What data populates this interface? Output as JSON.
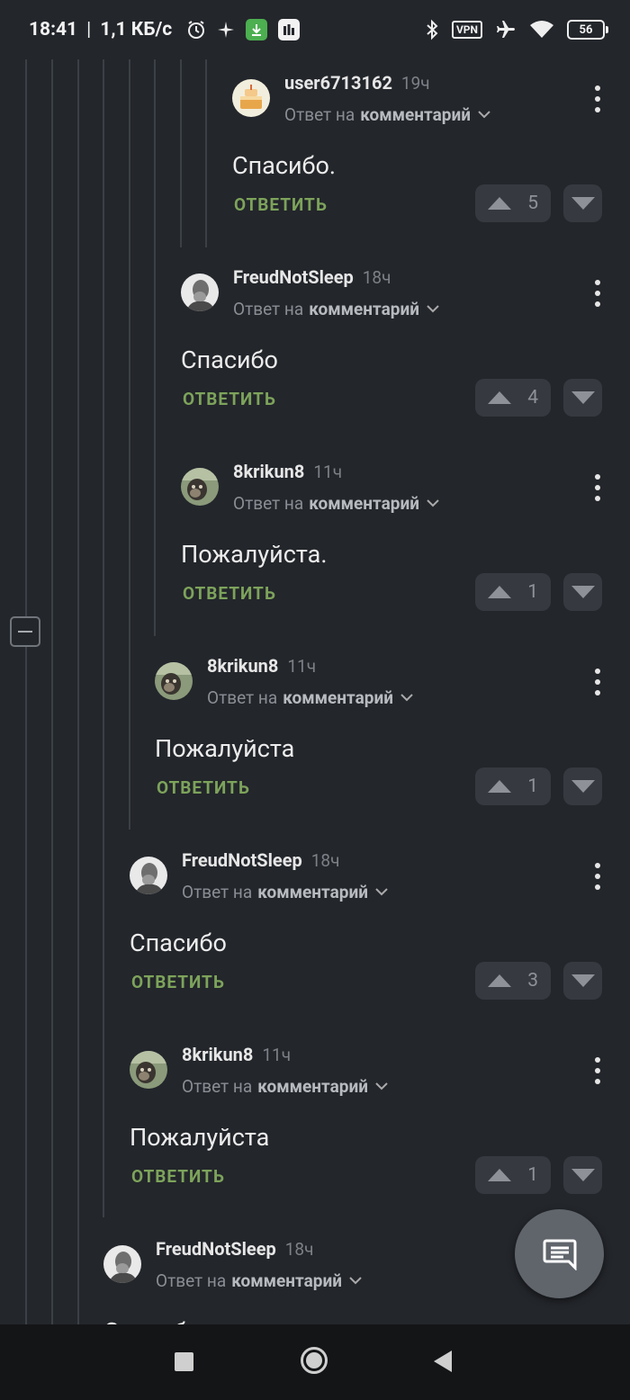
{
  "status_bar": {
    "time": "18:41",
    "separator": "|",
    "speed": "1,1 КБ/с",
    "vpn_label": "VPN",
    "battery_level": "56",
    "icons": [
      "alarm-icon",
      "sparkle-icon",
      "download-icon",
      "app-icon",
      "bluetooth-icon",
      "vpn-icon",
      "airplane-icon",
      "wifi-icon",
      "battery-icon"
    ]
  },
  "labels": {
    "reply_to": "Ответ на",
    "comment_word": "комментарий",
    "reply_button": "ОТВЕТИТЬ"
  },
  "comments": [
    {
      "user": "user6713162",
      "time": "19ч",
      "text": "Спасибо.",
      "votes": "5",
      "avatar": "cake-avatar"
    },
    {
      "user": "FreudNotSleep",
      "time": "18ч",
      "text": "Спасибо",
      "votes": "4",
      "avatar": "freud-avatar"
    },
    {
      "user": "8krikun8",
      "time": "11ч",
      "text": "Пожалуйста.",
      "votes": "1",
      "avatar": "dog-avatar"
    },
    {
      "user": "8krikun8",
      "time": "11ч",
      "text": "Пожалуйста",
      "votes": "1",
      "avatar": "dog-avatar"
    },
    {
      "user": "FreudNotSleep",
      "time": "18ч",
      "text": "Спасибо",
      "votes": "3",
      "avatar": "freud-avatar"
    },
    {
      "user": "8krikun8",
      "time": "11ч",
      "text": "Пожалуйста",
      "votes": "1",
      "avatar": "dog-avatar"
    },
    {
      "user": "FreudNotSleep",
      "time": "18ч",
      "text": "Спасибо",
      "votes": "",
      "avatar": "freud-avatar"
    }
  ],
  "colors": {
    "background": "#23262b",
    "reply_green": "#7da35b",
    "vote_bg": "#363a40",
    "thread_line": "#3b4046"
  },
  "fab": {
    "icon": "comment-icon"
  },
  "nav": {
    "icons": [
      "recents-icon",
      "home-icon",
      "back-icon"
    ]
  }
}
